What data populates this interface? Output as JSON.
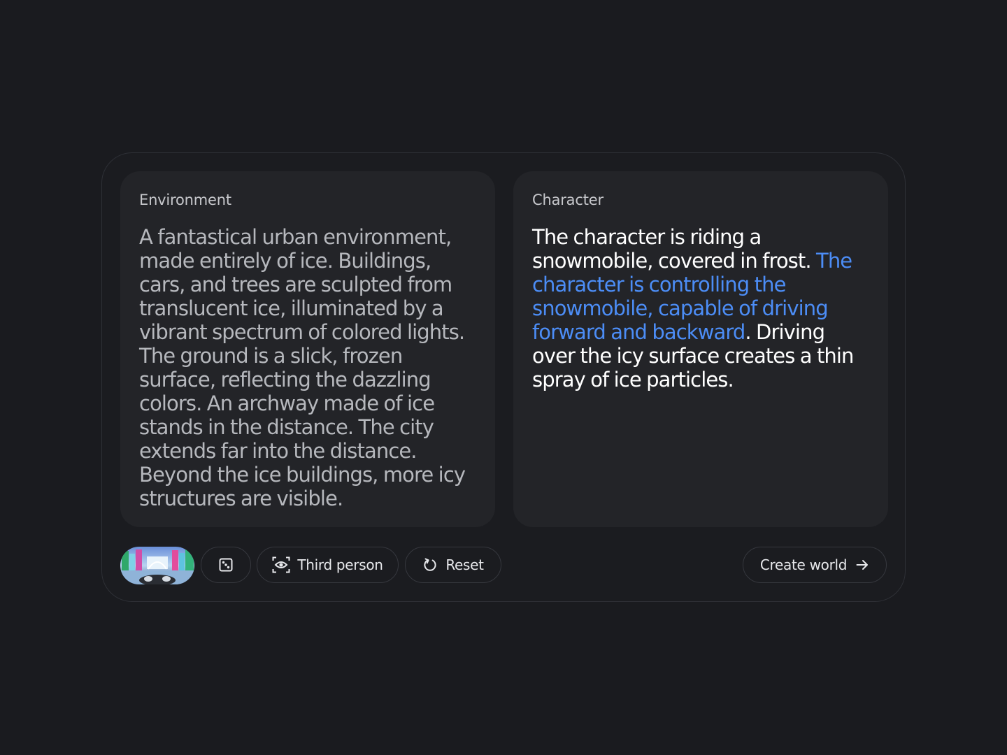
{
  "environment": {
    "label": "Environment",
    "text": "A fantastical urban environment, made entirely of ice. Buildings, cars, and trees are sculpted from translucent ice, illuminated by a vibrant spectrum of colored lights. The ground is a slick, frozen surface, reflecting the dazzling colors. An archway made of ice stands in the distance. The city extends far into the distance. Beyond the ice buildings, more icy structures are visible."
  },
  "character": {
    "label": "Character",
    "text_before": "The character is riding a snowmobile, covered in frost. ",
    "text_highlight": "The character is controlling the snowmobile, capable of driving forward and backward",
    "text_after": ". Driving over the icy surface creates a thin spray of ice particles."
  },
  "controls": {
    "thumbnail_icon": "ice-city-thumbnail",
    "dice_icon": "dice-icon",
    "camera_icon": "eye-icon",
    "camera_label": "Third person",
    "reset_icon": "reset-icon",
    "reset_label": "Reset",
    "create_label": "Create world",
    "create_icon": "arrow-right-icon"
  },
  "colors": {
    "background": "#1a1b1f",
    "card": "#232428",
    "highlight": "#4c8df6",
    "muted_text": "#b6b8bd"
  }
}
